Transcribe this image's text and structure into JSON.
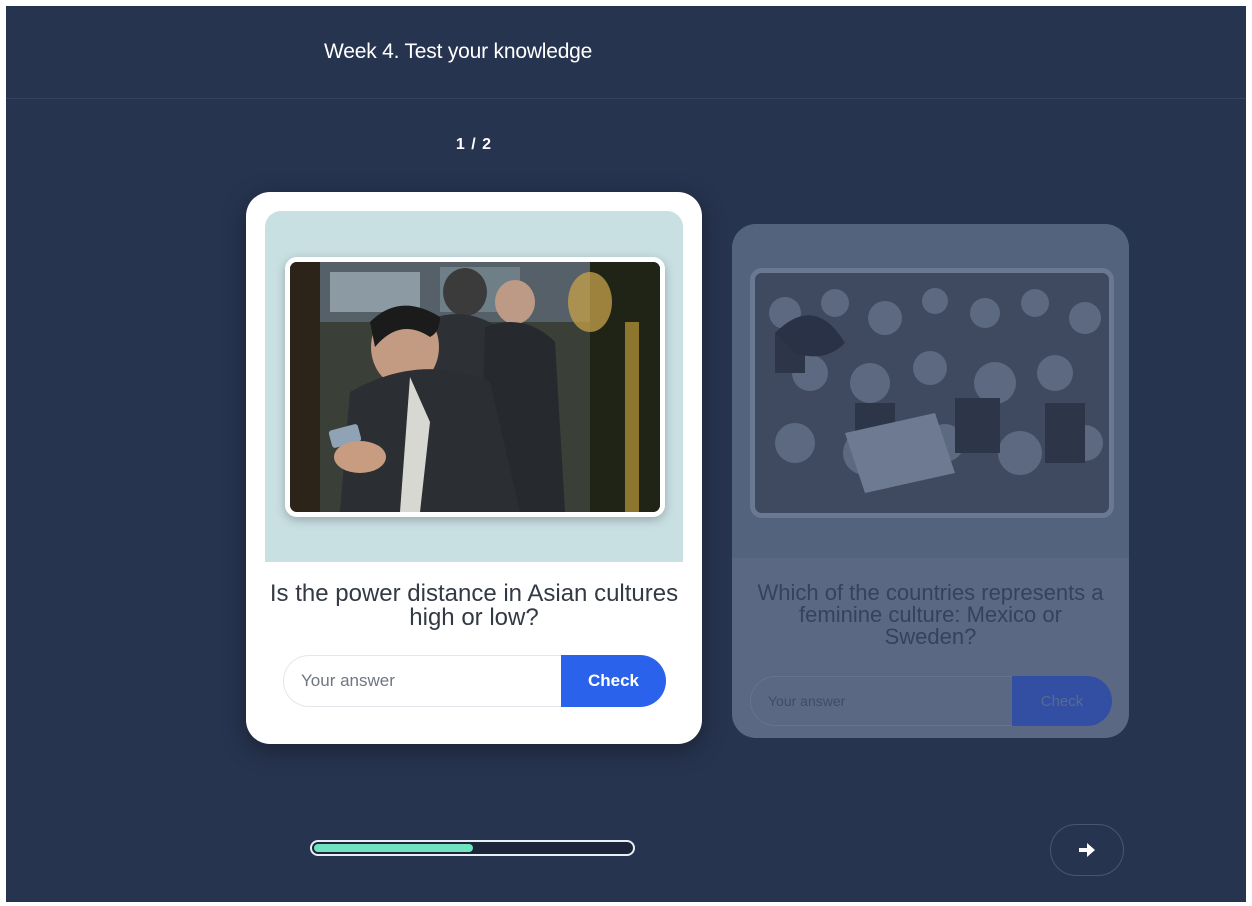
{
  "header": {
    "title": "Week 4. Test your knowledge"
  },
  "counter": "1 / 2",
  "cards": [
    {
      "question": "Is the power distance in Asian cultures high or low?",
      "answer_placeholder": "Your answer",
      "check_label": "Check",
      "image": "businessmen-phones-photo"
    },
    {
      "question": "Which of the countries represents a feminine culture: Mexico or Sweden?",
      "answer_placeholder": "Your answer",
      "check_label": "Check",
      "image": "celebrating-crowd-photo"
    }
  ],
  "progress": {
    "fraction": 0.5
  },
  "navigation": {
    "next_icon": "arrow-right-icon"
  },
  "colors": {
    "background": "#27344f",
    "accent": "#2a62ec",
    "progress": "#6fe3be",
    "image_panel": "#c9e0e3"
  }
}
